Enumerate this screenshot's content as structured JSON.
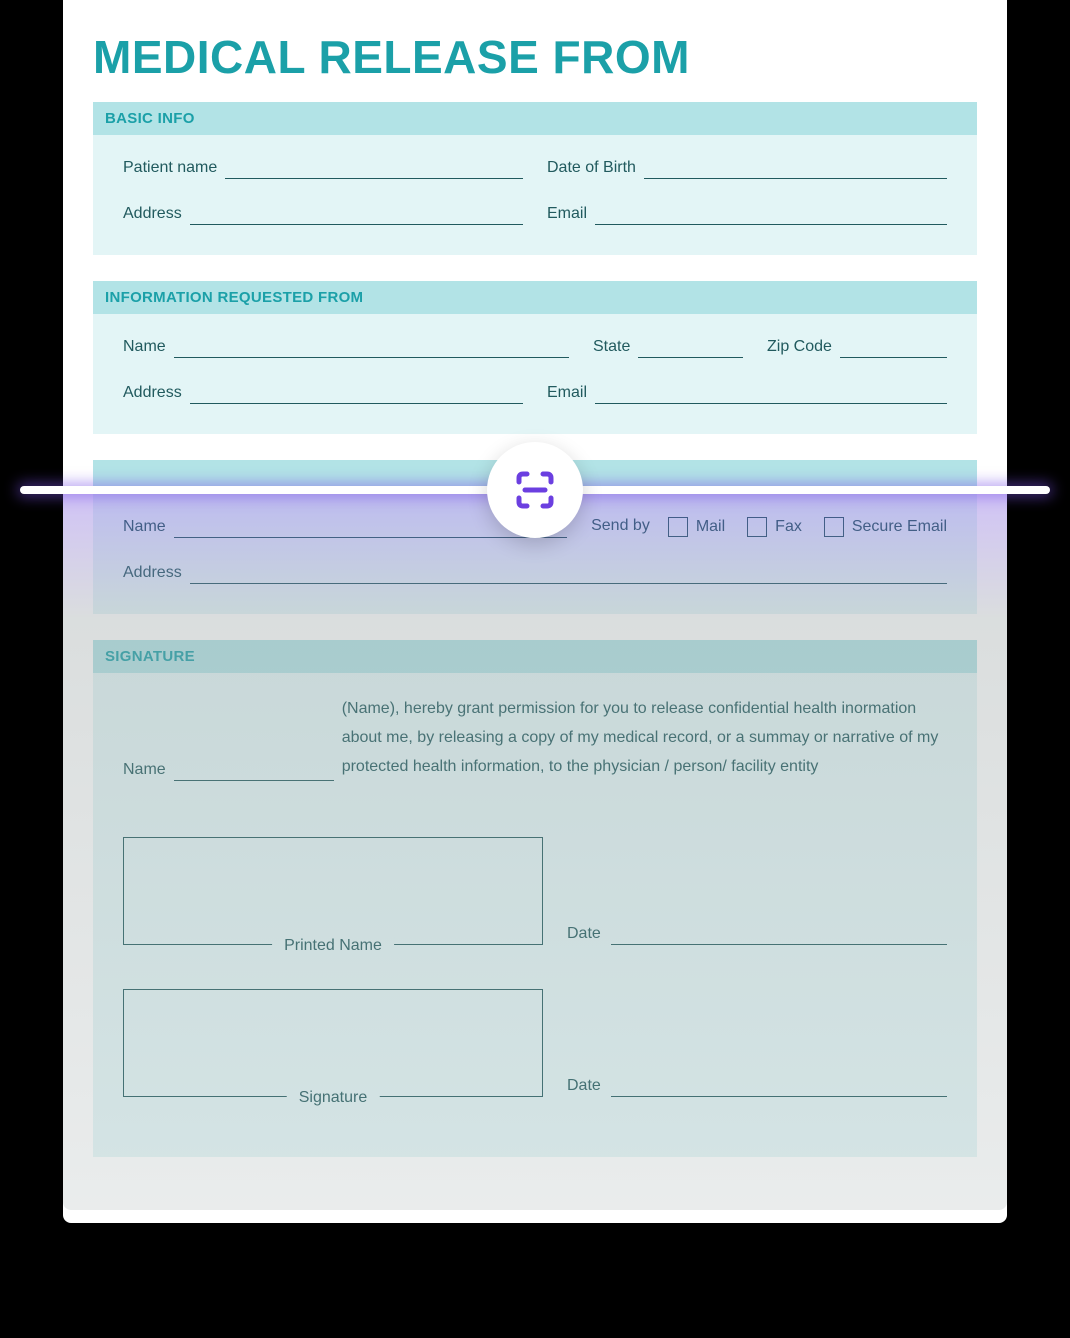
{
  "title": "MEDICAL RELEASE FROM",
  "sections": {
    "basic": {
      "header": "BASIC INFO",
      "fields": {
        "patient_name": "Patient name",
        "dob": "Date of Birth",
        "address": "Address",
        "email": "Email"
      }
    },
    "requested_from": {
      "header": "INFORMATION REQUESTED FROM",
      "fields": {
        "name": "Name",
        "state": "State",
        "zip": "Zip Code",
        "address": "Address",
        "email": "Email"
      }
    },
    "send_to": {
      "header": "",
      "fields": {
        "name": "Name",
        "send_by": "Send by",
        "address": "Address"
      },
      "options": {
        "mail": "Mail",
        "fax": "Fax",
        "secure_email": "Secure Email"
      }
    },
    "signature": {
      "header": "SIGNATURE",
      "fields": {
        "name": "Name",
        "printed_name": "Printed Name",
        "signature": "Signature",
        "date": "Date"
      },
      "consent_text": "(Name), hereby grant permission for you to release confidential health inormation about me, by releasing a copy of my medical record, or a summay or narrative of my protected health information, to the physician / person/ facility entity"
    }
  },
  "icons": {
    "scan": "scan-icon"
  },
  "colors": {
    "accent": "#1ba0a8",
    "section_header_bg": "#b2e3e6",
    "section_body_bg": "#e3f5f6",
    "text": "#215a5e",
    "scan_purple": "#6b3fe0"
  }
}
